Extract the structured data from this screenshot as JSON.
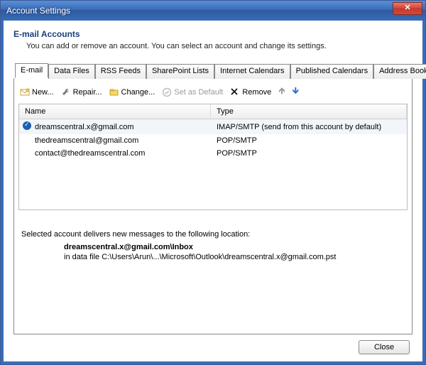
{
  "window": {
    "title": "Account Settings"
  },
  "header": {
    "title": "E-mail Accounts",
    "subtitle": "You can add or remove an account. You can select an account and change its settings."
  },
  "tabs": [
    {
      "label": "E-mail",
      "active": true
    },
    {
      "label": "Data Files"
    },
    {
      "label": "RSS Feeds"
    },
    {
      "label": "SharePoint Lists"
    },
    {
      "label": "Internet Calendars"
    },
    {
      "label": "Published Calendars"
    },
    {
      "label": "Address Books"
    }
  ],
  "toolbar": {
    "new": "New...",
    "repair": "Repair...",
    "change": "Change...",
    "set_default": "Set as Default",
    "remove": "Remove"
  },
  "table": {
    "columns": {
      "name": "Name",
      "type": "Type"
    },
    "rows": [
      {
        "default": true,
        "name": "dreamscentral.x@gmail.com",
        "type": "IMAP/SMTP (send from this account by default)"
      },
      {
        "default": false,
        "name": "thedreamscentral@gmail.com",
        "type": "POP/SMTP"
      },
      {
        "default": false,
        "name": "contact@thedreamscentral.com",
        "type": "POP/SMTP"
      }
    ]
  },
  "footer": {
    "lead": "Selected account delivers new messages to the following location:",
    "location_bold": "dreamscentral.x@gmail.com\\Inbox",
    "location_path": "in data file C:\\Users\\Arun\\...\\Microsoft\\Outlook\\dreamscentral.x@gmail.com.pst"
  },
  "buttons": {
    "close": "Close"
  }
}
